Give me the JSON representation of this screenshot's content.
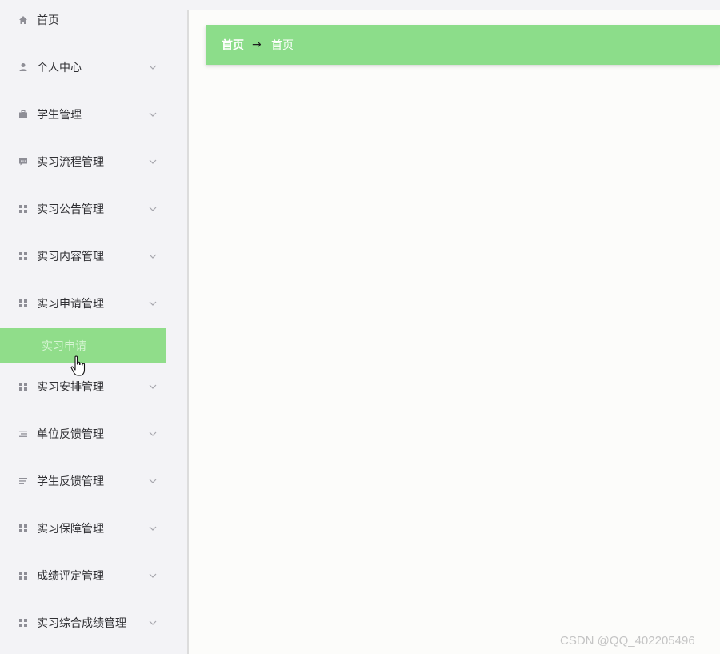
{
  "sidebar": {
    "items": [
      {
        "label": "首页",
        "icon": "home-icon",
        "has_chevron": false
      },
      {
        "label": "个人中心",
        "icon": "user-icon",
        "has_chevron": true
      },
      {
        "label": "学生管理",
        "icon": "briefcase-icon",
        "has_chevron": true
      },
      {
        "label": "实习流程管理",
        "icon": "chat-icon",
        "has_chevron": true
      },
      {
        "label": "实习公告管理",
        "icon": "grid-icon",
        "has_chevron": true
      },
      {
        "label": "实习内容管理",
        "icon": "grid-icon",
        "has_chevron": true
      },
      {
        "label": "实习申请管理",
        "icon": "grid-icon",
        "has_chevron": true
      },
      {
        "label": "实习安排管理",
        "icon": "grid-icon",
        "has_chevron": true
      },
      {
        "label": "单位反馈管理",
        "icon": "list-icon",
        "has_chevron": true
      },
      {
        "label": "学生反馈管理",
        "icon": "list-icon",
        "has_chevron": true
      },
      {
        "label": "实习保障管理",
        "icon": "grid-icon",
        "has_chevron": true
      },
      {
        "label": "成绩评定管理",
        "icon": "grid-icon",
        "has_chevron": true
      },
      {
        "label": "实习综合成绩管理",
        "icon": "grid-icon",
        "has_chevron": true
      }
    ],
    "active_subitem": {
      "label": "实习申请",
      "parent": "实习申请管理"
    }
  },
  "breadcrumb": {
    "home": "首页",
    "separator": "→",
    "current": "首页"
  },
  "watermark": "CSDN @QQ_402205496",
  "colors": {
    "accent": "#8cdd8a",
    "sidebar_bg": "#f3f3f6",
    "content_bg": "#fcfcfa"
  }
}
